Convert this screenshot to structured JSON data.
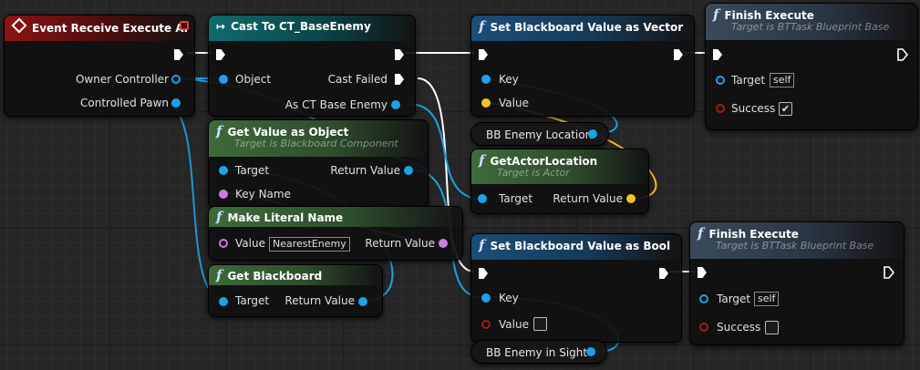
{
  "colors": {
    "object_pin": "#1aa3e6",
    "name_pin": "#cc7be0",
    "vector_pin": "#f5c125",
    "bool_pin": "#a31b1b",
    "exec_pin": "#ffffff"
  },
  "event_receive": {
    "title": "Event Receive Execute AI",
    "owner_controller": "Owner Controller",
    "controlled_pawn": "Controlled Pawn"
  },
  "cast_node": {
    "title": "Cast To CT_BaseEnemy",
    "object_label": "Object",
    "cast_failed": "Cast Failed",
    "as_ct_base_enemy": "As CT Base Enemy"
  },
  "set_bb_vector": {
    "title": "Set Blackboard Value as Vector",
    "key": "Key",
    "value": "Value"
  },
  "finish_top": {
    "title": "Finish Execute",
    "subtitle": "Target is BTTask Blueprint Base",
    "target": "Target",
    "target_value": "self",
    "success": "Success",
    "success_checked": true
  },
  "get_value_as_object": {
    "title": "Get Value as Object",
    "subtitle": "Target is Blackboard Component",
    "target": "Target",
    "return_value": "Return Value",
    "key_name": "Key Name"
  },
  "bb_enemy_location": {
    "label": "BB Enemy Location"
  },
  "get_actor_location": {
    "title": "GetActorLocation",
    "subtitle": "Target is Actor",
    "target": "Target",
    "return_value": "Return Value"
  },
  "make_literal_name": {
    "title": "Make Literal Name",
    "value": "Value",
    "value_text": "NearestEnemy",
    "return_value": "Return Value"
  },
  "set_bb_bool": {
    "title": "Set Blackboard Value as Bool",
    "key": "Key",
    "value": "Value",
    "value_checked": false
  },
  "finish_bottom": {
    "title": "Finish Execute",
    "subtitle": "Target is BTTask Blueprint Base",
    "target": "Target",
    "target_value": "self",
    "success": "Success",
    "success_checked": false
  },
  "get_blackboard": {
    "title": "Get Blackboard",
    "target": "Target",
    "return_value": "Return Value"
  },
  "bb_enemy_in_sight": {
    "label": "BB Enemy in Sight"
  },
  "icons": {
    "function": "function-icon",
    "event": "event-diamond-icon",
    "cast": "cast-arrow-icon",
    "checkmark": "checkmark-icon"
  }
}
